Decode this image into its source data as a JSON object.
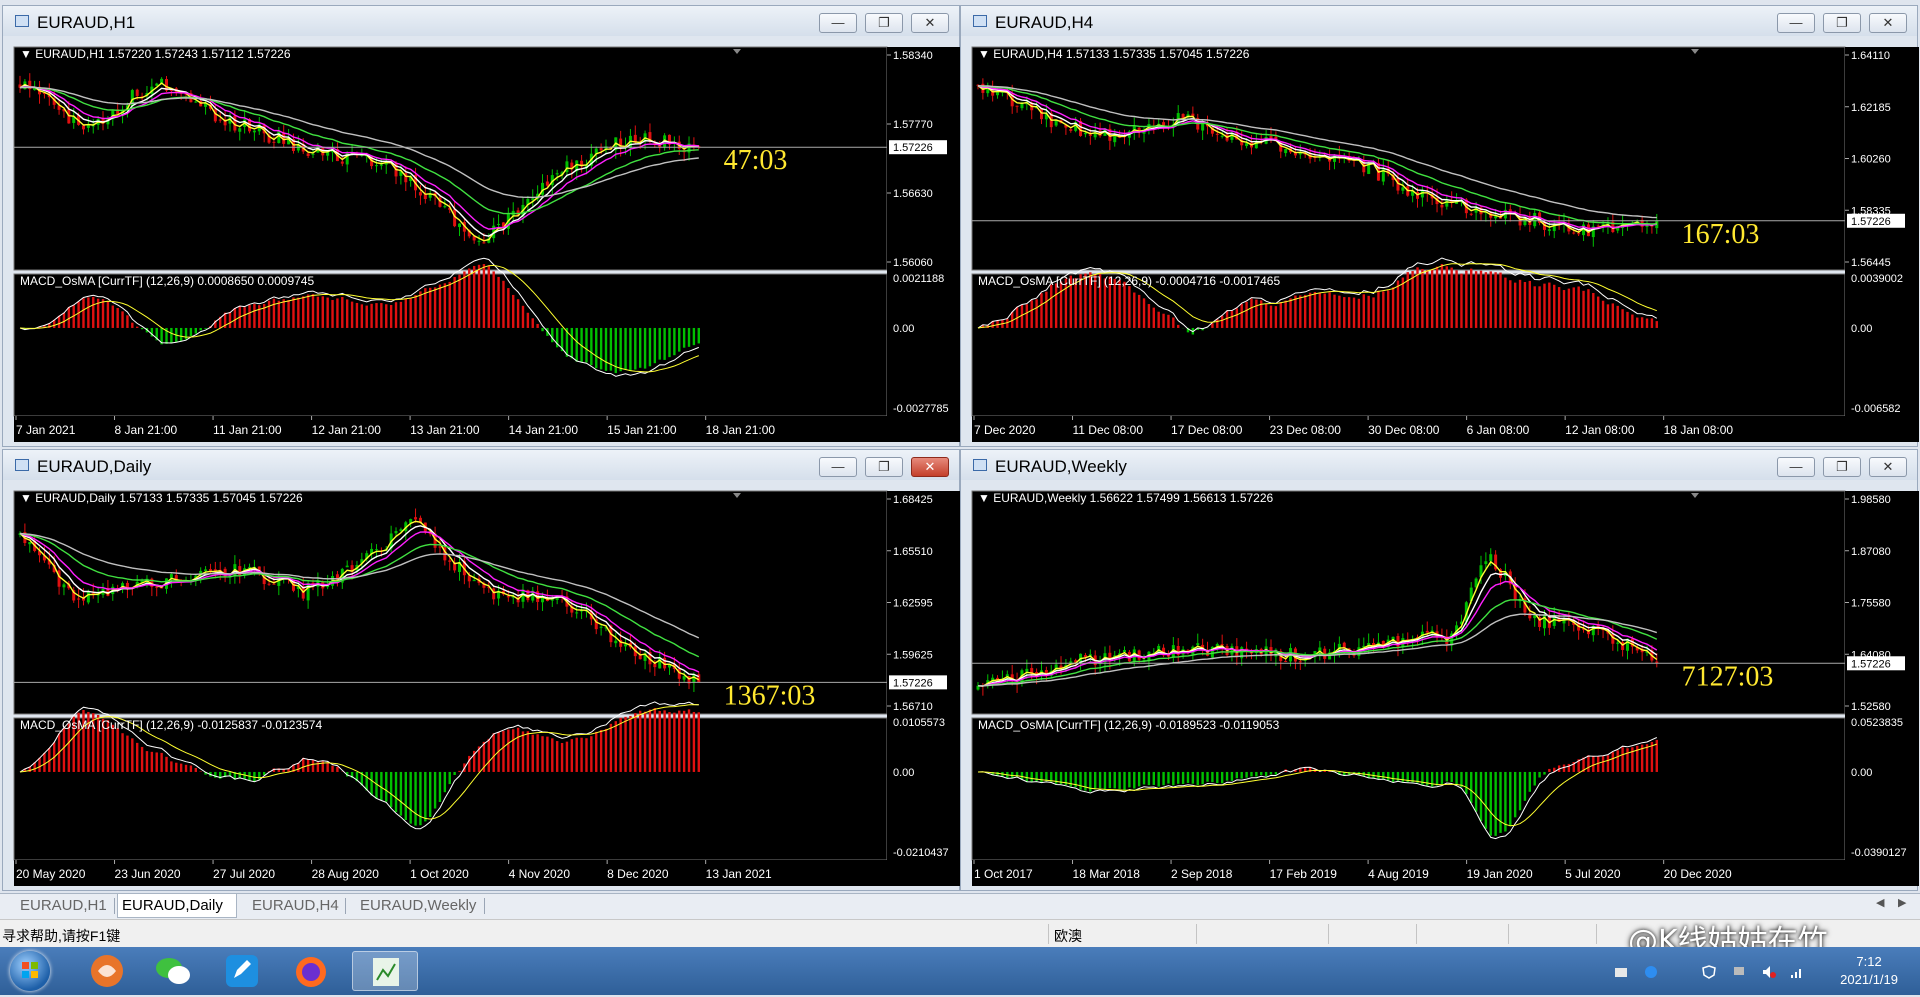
{
  "windows": [
    {
      "title": "EURAUD,H1",
      "info": "EURAUD,H1  1.57220 1.57243 1.57112 1.57226",
      "price_labels": [
        "1.58340",
        "1.57770",
        "1.56630",
        "1.56060"
      ],
      "current_price": "1.57226",
      "countdown": "47:03",
      "macd_label": "MACD_OsMA [CurrTF] (12,26,9) 0.0008650 0.0009745",
      "macd_labels": [
        "0.0021188",
        "0.00",
        "-0.0027785"
      ],
      "time_labels": [
        "7 Jan 2021",
        "8 Jan 21:00",
        "11 Jan 21:00",
        "12 Jan 21:00",
        "13 Jan 21:00",
        "14 Jan 21:00",
        "15 Jan 21:00",
        "18 Jan 21:00"
      ],
      "close_active": false
    },
    {
      "title": "EURAUD,H4",
      "info": "EURAUD,H4  1.57133 1.57335 1.57045 1.57226",
      "price_labels": [
        "1.64110",
        "1.62185",
        "1.60260",
        "1.58335",
        "1.56445"
      ],
      "current_price": "1.57226",
      "countdown": "167:03",
      "macd_label": "MACD_OsMA [CurrTF] (12,26,9) -0.0004716 -0.0017465",
      "macd_labels": [
        "0.0039002",
        "0.00",
        "-0.006582"
      ],
      "time_labels": [
        "7 Dec 2020",
        "11 Dec 08:00",
        "17 Dec 08:00",
        "23 Dec 08:00",
        "30 Dec 08:00",
        "6 Jan 08:00",
        "12 Jan 08:00",
        "18 Jan 08:00"
      ],
      "close_active": false
    },
    {
      "title": "EURAUD,Daily",
      "info": "EURAUD,Daily  1.57133 1.57335 1.57045 1.57226",
      "price_labels": [
        "1.68425",
        "1.65510",
        "1.62595",
        "1.59625",
        "1.56710"
      ],
      "current_price": "1.57226",
      "countdown": "1367:03",
      "macd_label": "MACD_OsMA [CurrTF] (12,26,9) -0.0125837 -0.0123574",
      "macd_labels": [
        "0.0105573",
        "0.00",
        "-0.0210437"
      ],
      "time_labels": [
        "20 May 2020",
        "23 Jun 2020",
        "27 Jul 2020",
        "28 Aug 2020",
        "1 Oct 2020",
        "4 Nov 2020",
        "8 Dec 2020",
        "13 Jan 2021"
      ],
      "close_active": true
    },
    {
      "title": "EURAUD,Weekly",
      "info": "EURAUD,Weekly  1.56622 1.57499 1.56613 1.57226",
      "price_labels": [
        "1.98580",
        "1.87080",
        "1.75580",
        "1.64080",
        "1.52580"
      ],
      "current_price": "1.57226",
      "countdown": "7127:03",
      "macd_label": "MACD_OsMA [CurrTF] (12,26,9) -0.0189523 -0.0119053",
      "macd_labels": [
        "0.0523835",
        "0.00",
        "-0.0390127"
      ],
      "time_labels": [
        "1 Oct 2017",
        "18 Mar 2018",
        "2 Sep 2018",
        "17 Feb 2019",
        "4 Aug 2019",
        "19 Jan 2020",
        "5 Jul 2020",
        "20 Dec 2020"
      ],
      "close_active": false
    }
  ],
  "window_buttons": {
    "minimize": "—",
    "maximize": "❐",
    "close": "✕"
  },
  "tabs": [
    "EURAUD,H1",
    "EURAUD,Daily",
    "EURAUD,H4",
    "EURAUD,Weekly"
  ],
  "active_tab": "EURAUD,Daily",
  "status": {
    "help": "寻求帮助,请按F1键",
    "profile": "欧澳"
  },
  "clock": {
    "time": "7:12",
    "date": "2021/1/19"
  },
  "watermark": "@K线姑姑在竹",
  "colors": {
    "chart_bg": "#000000",
    "bull": "#00c000",
    "bear": "#e01010",
    "ma_yellow": "#ffff30",
    "ma_white": "#ffffff",
    "ma_magenta": "#ff20ff",
    "ma_green": "#40e040",
    "ma_gray": "#c0c0c0",
    "countdown": "#ffe830"
  }
}
